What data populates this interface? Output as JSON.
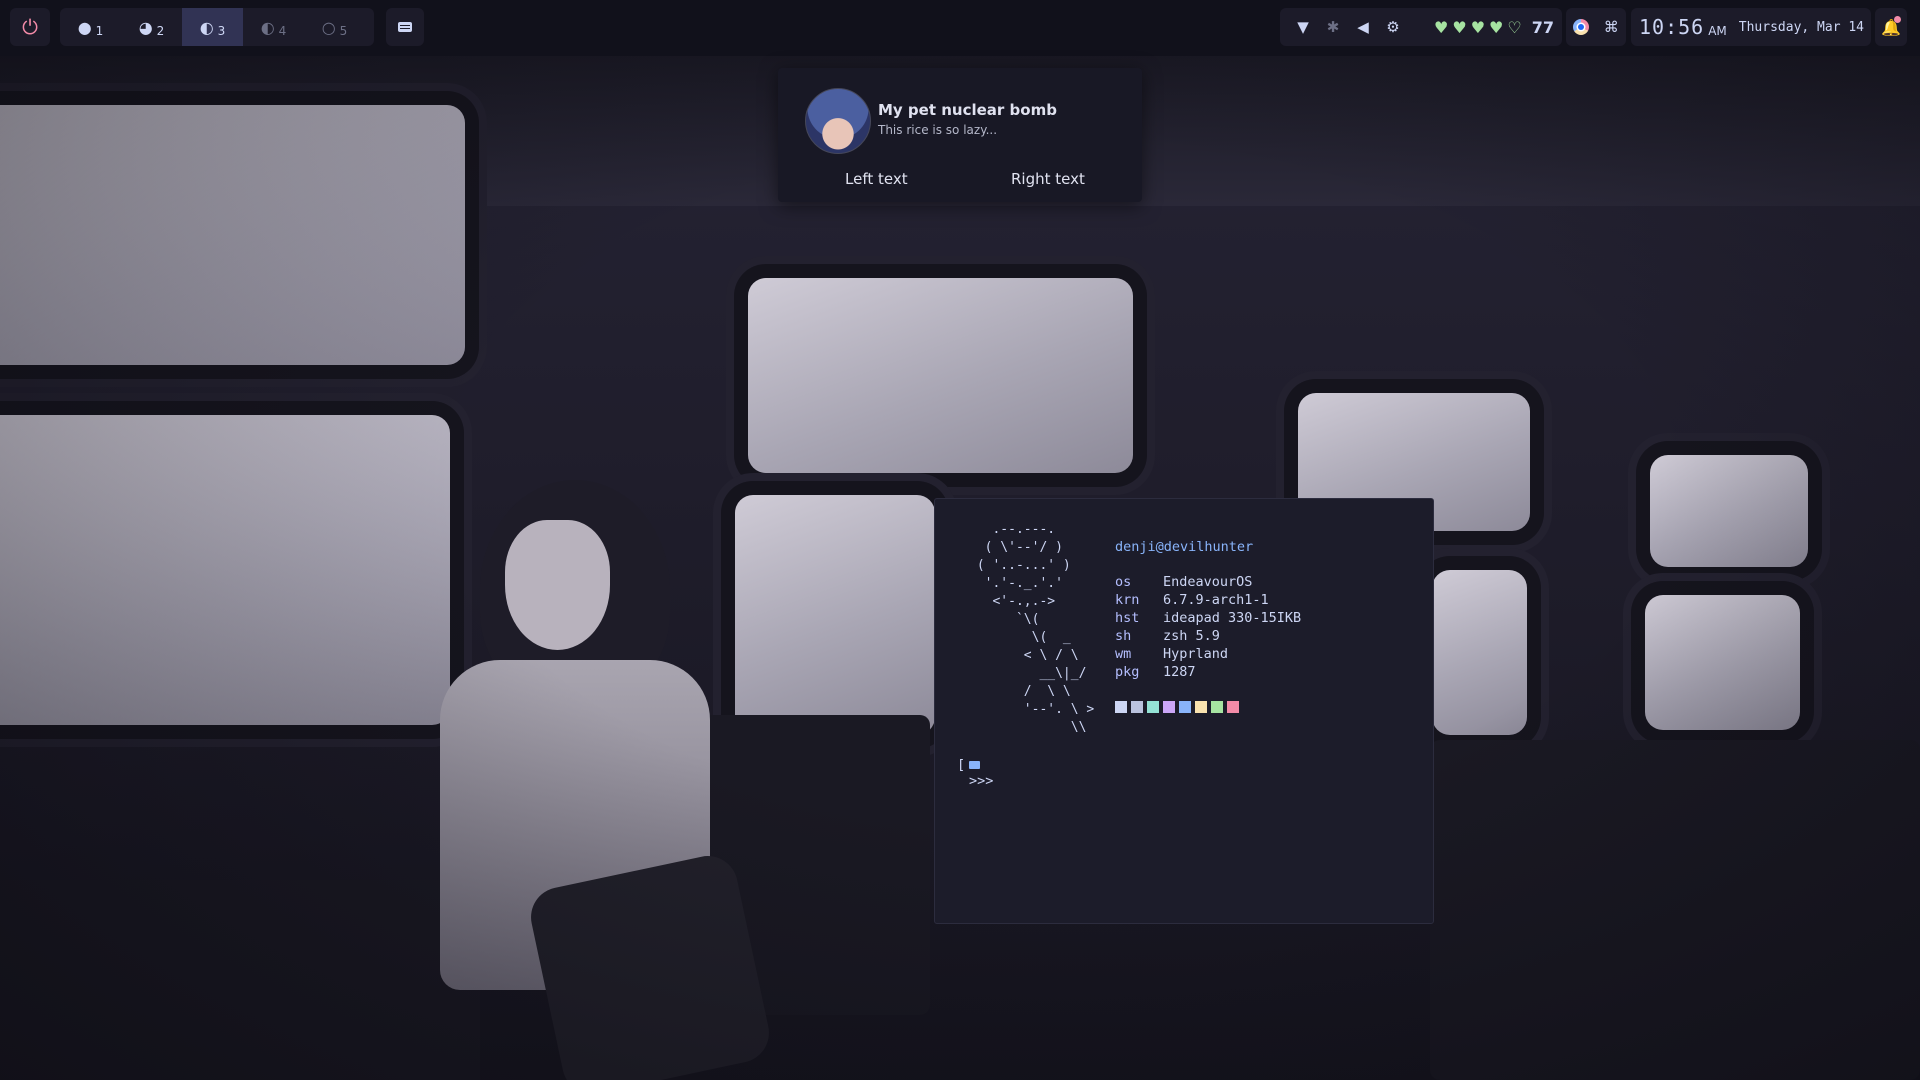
{
  "topbar": {
    "power_icon": "power-icon",
    "workspaces": [
      {
        "label": "1",
        "icon": "moon-full-icon",
        "glyph": "●",
        "state": "normal"
      },
      {
        "label": "2",
        "icon": "moon-gibbous-icon",
        "glyph": "◕",
        "state": "normal"
      },
      {
        "label": "3",
        "icon": "moon-half-icon",
        "glyph": "◐",
        "state": "active"
      },
      {
        "label": "4",
        "icon": "moon-crescent-icon",
        "glyph": "◐",
        "state": "dim"
      },
      {
        "label": "5",
        "icon": "moon-new-icon",
        "glyph": "○",
        "state": "dim"
      }
    ],
    "keyboard_icon": "keyboard-icon",
    "tray_icons": [
      "wifi-icon",
      "bluetooth-icon",
      "volume-icon",
      "settings-icon"
    ],
    "battery": {
      "hearts_full": 4,
      "hearts_empty": 1,
      "percent": "77"
    },
    "misc_icons": [
      "chrome-icon",
      "command-icon"
    ],
    "clock": {
      "time": "10:56",
      "ampm": "AM",
      "date": "Thursday, Mar 14"
    },
    "notification_icon": "bell-icon"
  },
  "notification": {
    "title": "My pet nuclear bomb",
    "body": "This rice is so lazy...",
    "actions": {
      "left": "Left text",
      "right": "Right text"
    }
  },
  "terminal": {
    "ascii": "   .--.---.\n  ( \\'--'/ )\n ( '..-...' )\n  '.'-._.'.'\n   <'-.,.->\n      `\\(\n        \\(  _\n       < \\ / \\\n         __\\|_/\n       /  \\ \\\n       '--'. \\ >\n             \\\\",
    "user": "denji@devilhunter",
    "info": [
      {
        "key": "os",
        "value": "EndeavourOS"
      },
      {
        "key": "krn",
        "value": "6.7.9-arch1-1"
      },
      {
        "key": "hst",
        "value": "ideapad 330-15IKB"
      },
      {
        "key": "sh",
        "value": "zsh 5.9"
      },
      {
        "key": "wm",
        "value": "Hyprland"
      },
      {
        "key": "pkg",
        "value": "1287"
      }
    ],
    "palette": [
      "#cdd6f4",
      "#bac2de",
      "#94e2d5",
      "#cba6f7",
      "#89b4fa",
      "#f9e2af",
      "#a6e3a1",
      "#f38ba8"
    ],
    "prompt": {
      "bracket": "[",
      "arrows": ">>>"
    }
  }
}
